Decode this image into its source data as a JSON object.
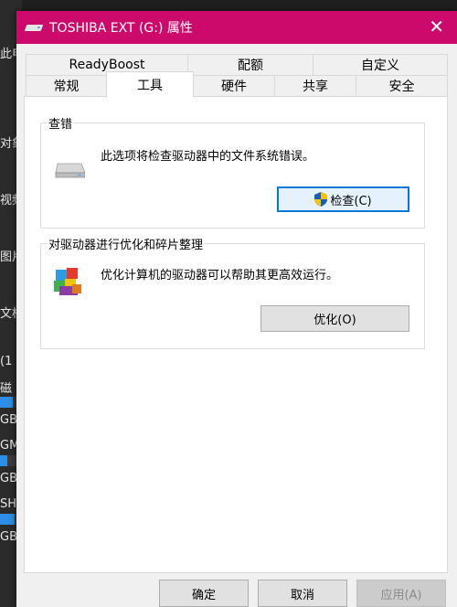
{
  "background": {
    "fragments": [
      "此电",
      "对象",
      "视频",
      "图片",
      "文档",
      "(1",
      "磁",
      "GB",
      "GM",
      "GB",
      "SHI",
      "GB"
    ]
  },
  "dialog": {
    "title": "TOSHIBA EXT (G:) 属性",
    "close_glyph": "✕",
    "tabs_row1": [
      "ReadyBoost",
      "配额",
      "自定义"
    ],
    "tabs_row2": [
      "常规",
      "工具",
      "硬件",
      "共享",
      "安全"
    ],
    "active_tab": "工具",
    "check_group": {
      "label": "查错",
      "description": "此选项将检查驱动器中的文件系统错误。",
      "button": "检查(C)"
    },
    "optimize_group": {
      "label": "对驱动器进行优化和碎片整理",
      "description": "优化计算机的驱动器可以帮助其更高效运行。",
      "button": "优化(O)"
    },
    "footer": {
      "ok": "确定",
      "cancel": "取消",
      "apply": "应用(A)"
    }
  },
  "colors": {
    "titlebar": "#cc0a6c",
    "accent": "#0078d7"
  }
}
